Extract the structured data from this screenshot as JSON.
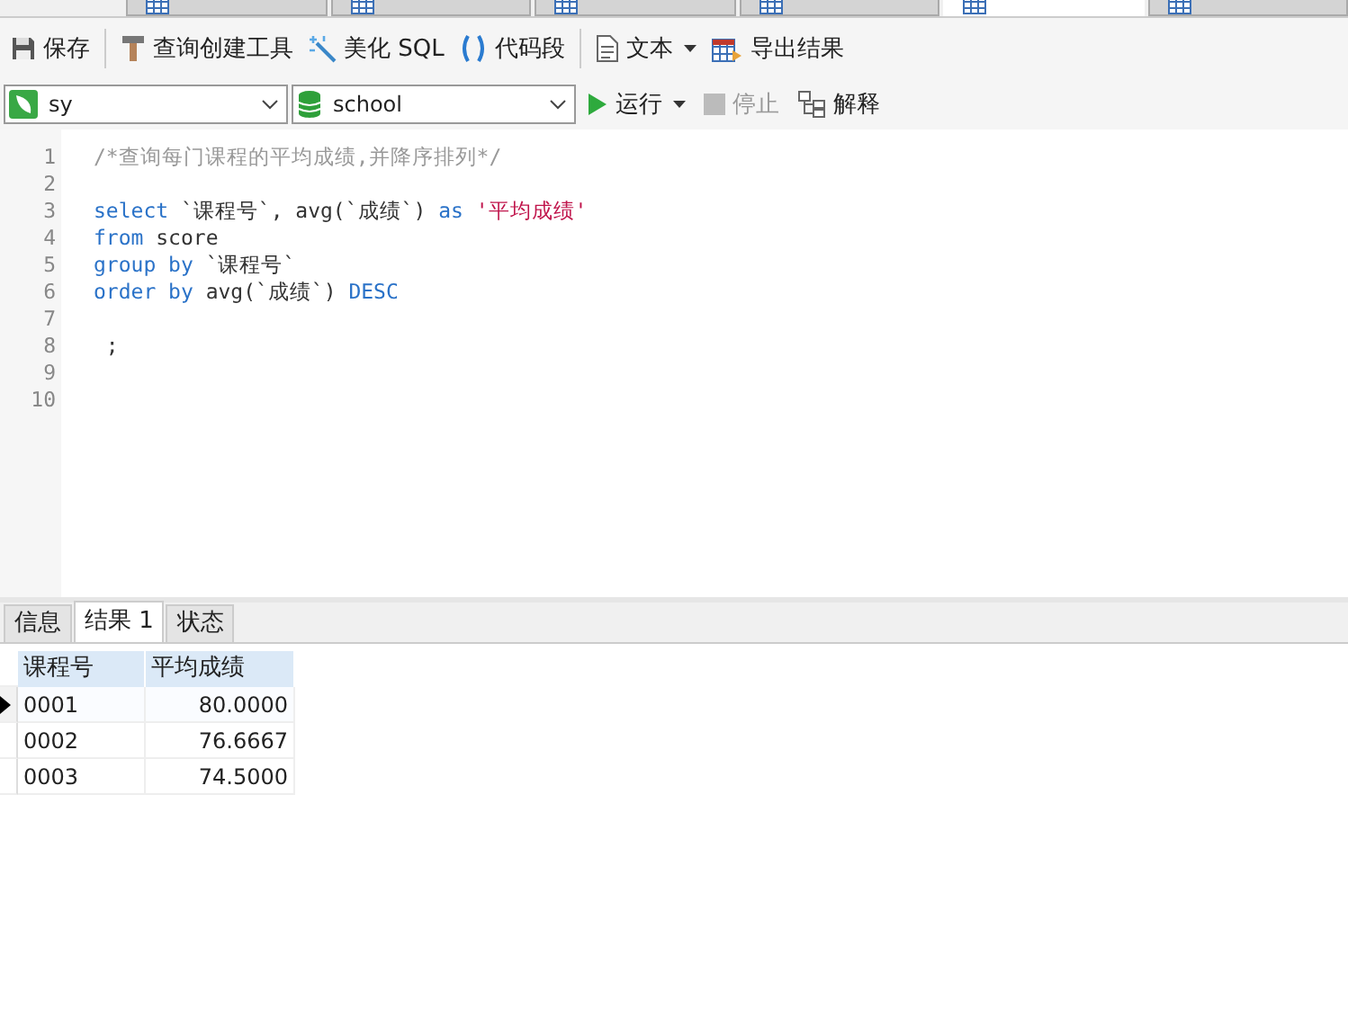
{
  "doc_tabs": [
    {
      "selected": false
    },
    {
      "selected": false
    },
    {
      "selected": false
    },
    {
      "selected": false
    },
    {
      "selected": true
    },
    {
      "selected": false
    }
  ],
  "toolbar": [
    {
      "label": "保存"
    },
    {
      "label": "查询创建工具"
    },
    {
      "label": "美化 SQL"
    },
    {
      "label": "代码段"
    },
    {
      "label": "文本",
      "dropdown": true
    },
    {
      "label": "导出结果"
    }
  ],
  "connection": {
    "value": "sy"
  },
  "database": {
    "value": "school"
  },
  "actions": [
    {
      "label": "运行",
      "dropdown": true,
      "disabled": false
    },
    {
      "label": "停止",
      "disabled": true
    },
    {
      "label": "解释",
      "disabled": false
    }
  ],
  "editor": {
    "lines": [
      {
        "number": "1",
        "tokens": [
          {
            "kind": "comment",
            "text": "/*查询每门课程的平均成绩,并降序排列*/"
          }
        ]
      },
      {
        "number": "2"
      },
      {
        "number": "3",
        "tokens": [
          {
            "kind": "keyword",
            "text": "select"
          },
          {
            "kind": "plain",
            "text": " `课程号`, avg(`成绩`) "
          },
          {
            "kind": "keyword",
            "text": "as"
          },
          {
            "kind": "string",
            "text": " '平均成绩'"
          }
        ]
      },
      {
        "number": "4",
        "tokens": [
          {
            "kind": "keyword",
            "text": "from"
          },
          {
            "kind": "plain",
            "text": " score"
          }
        ]
      },
      {
        "number": "5",
        "tokens": [
          {
            "kind": "keyword",
            "text": "group by"
          },
          {
            "kind": "plain",
            "text": " `课程号`"
          }
        ]
      },
      {
        "number": "6",
        "tokens": [
          {
            "kind": "keyword",
            "text": "order by"
          },
          {
            "kind": "plain",
            "text": " avg(`成绩`) "
          },
          {
            "kind": "keyword",
            "text": "DESC"
          }
        ]
      },
      {
        "number": "7"
      },
      {
        "number": "8",
        "tokens": [
          {
            "kind": "plain",
            "text": " ;"
          }
        ]
      },
      {
        "number": "9"
      },
      {
        "number": "10"
      }
    ]
  },
  "result_tabs": [
    {
      "label": "信息",
      "selected": false
    },
    {
      "label": "结果 1",
      "selected": true
    },
    {
      "label": "状态",
      "selected": false
    }
  ],
  "table": {
    "columns": [
      "课程号",
      "平均成绩"
    ],
    "rows": [
      {
        "cells": [
          "0001",
          "80.0000"
        ],
        "selected": true
      },
      {
        "cells": [
          "0002",
          "76.6667"
        ],
        "selected": false
      },
      {
        "cells": [
          "0003",
          "74.5000"
        ],
        "selected": false
      }
    ]
  }
}
